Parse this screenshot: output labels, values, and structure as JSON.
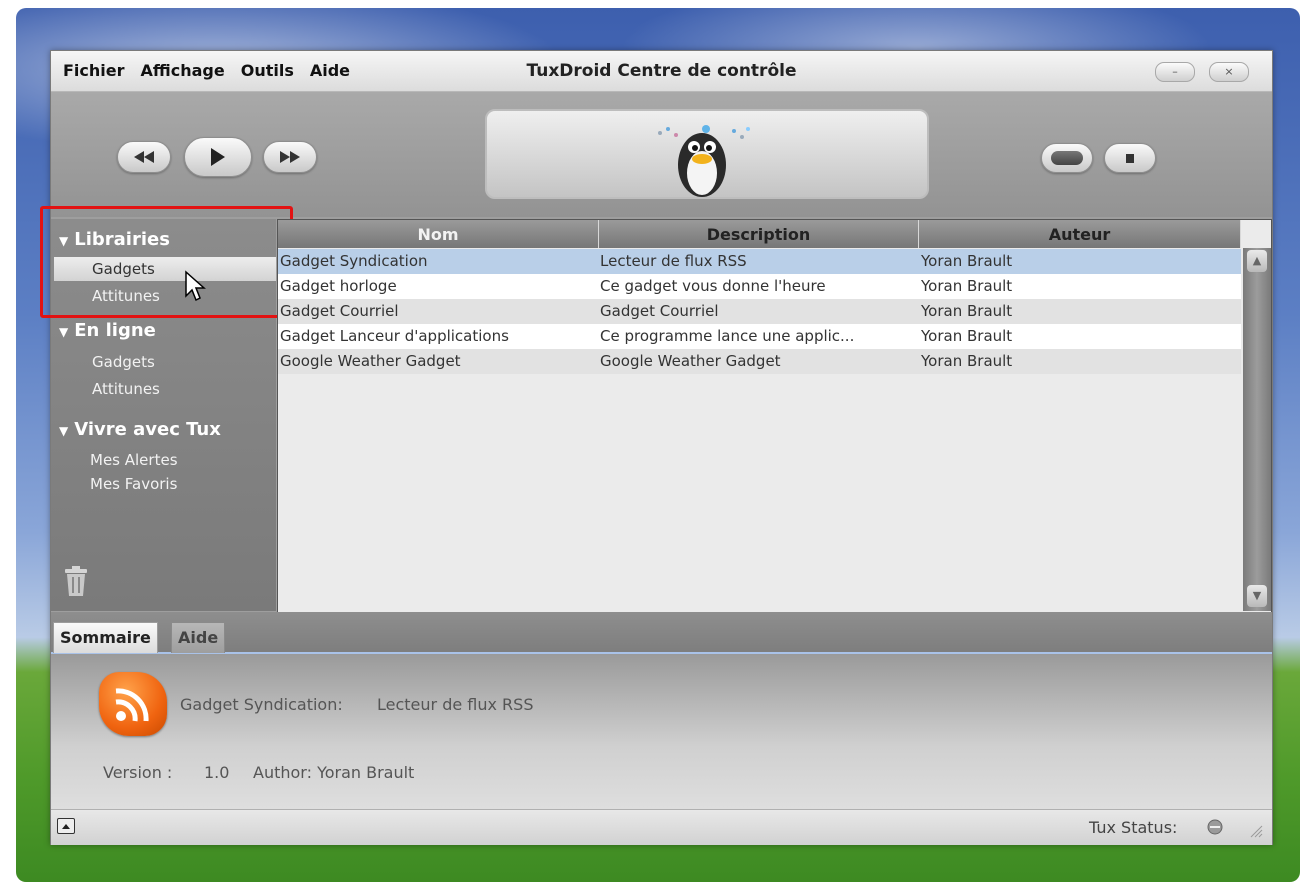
{
  "menu": [
    "Fichier",
    "Affichage",
    "Outils",
    "Aide"
  ],
  "window": {
    "title": "TuxDroid Centre de contrôle",
    "minimize_glyph": "–",
    "close_glyph": "×"
  },
  "sidebar": {
    "sections": [
      {
        "title": "Librairies",
        "items": [
          "Gadgets",
          "Attitunes"
        ]
      },
      {
        "title": "En ligne",
        "items": [
          "Gadgets",
          "Attitunes"
        ]
      },
      {
        "title": "Vivre avec Tux",
        "items": [
          "Mes Alertes",
          "Mes Favoris"
        ]
      }
    ],
    "selected": "Librairies / Gadgets"
  },
  "table": {
    "columns": [
      "Nom",
      "Description",
      "Auteur"
    ],
    "rows": [
      [
        "Gadget Syndication",
        "Lecteur de flux RSS",
        "Yoran Brault"
      ],
      [
        "Gadget horloge",
        "Ce gadget vous donne l'heure",
        "Yoran Brault"
      ],
      [
        "Gadget Courriel",
        "Gadget Courriel",
        "Yoran Brault"
      ],
      [
        "Gadget Lanceur d'applications",
        "Ce programme lance une applic...",
        "Yoran Brault"
      ],
      [
        "Google Weather Gadget",
        "Google Weather Gadget",
        "Yoran Brault"
      ]
    ],
    "selected_row": 0
  },
  "tabs": [
    "Sommaire",
    "Aide"
  ],
  "summary": {
    "name": "Gadget Syndication:",
    "description": "Lecteur de flux RSS",
    "version_label": "Version :",
    "version": "1.0",
    "author": "Author: Yoran Brault"
  },
  "status": {
    "label": "Tux Status:"
  },
  "colors": {
    "highlight": "#e31212",
    "selected_row": "#b9cfe8",
    "rss": "#f06410"
  }
}
